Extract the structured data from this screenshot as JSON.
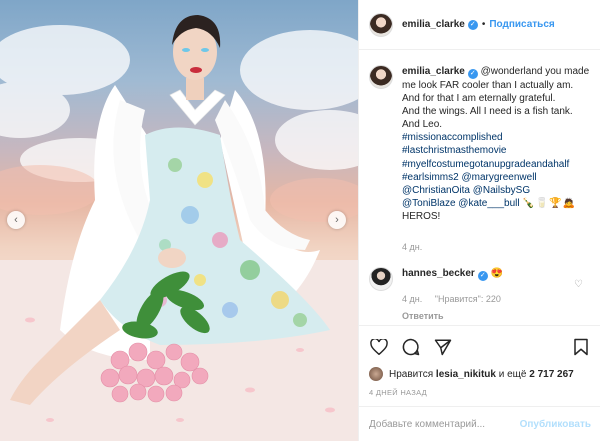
{
  "photo": {
    "prev_arrow": "‹",
    "next_arrow": "›"
  },
  "header": {
    "username": "emilia_clarke",
    "verified_icon": "✓",
    "separator": "•",
    "follow_label": "Подписаться"
  },
  "caption": {
    "username": "emilia_clarke",
    "verified_icon": "✓",
    "lines": [
      "@wonderland you made me look FAR cooler than I actually am.",
      "And for that I am eternally grateful.",
      "And the wings. All I need is a fish tank.",
      "And Leo."
    ],
    "tags": [
      "#missionaccomplished",
      "#lastchristmasthemovie",
      "#myelfcostumegotanupgradeandahalf"
    ],
    "mentions_line1": "#earlsimms2 @marygreenwell",
    "mentions_line2": "@ChristianOita @NailsbySG",
    "mentions_line3a": "@ToniBlaze @kate___bull",
    "mentions_line3_emoji": "🍾🥛🏆🙇",
    "closing": "HEROS!",
    "time": "4 дн."
  },
  "reply": {
    "username": "hannes_becker",
    "verified_icon": "✓",
    "text": "😍",
    "time": "4 дн.",
    "likes": "\"Нравится\": 220",
    "reply_label": "Ответить",
    "heart_icon": "♡"
  },
  "actions": {
    "likes_prefix": "Нравится",
    "likes_user": "lesia_nikituk",
    "likes_middle": "и ещё",
    "likes_count": "2 717 267",
    "time_ago": "4 дней назад"
  },
  "add_comment": {
    "placeholder": "Добавьте комментарий...",
    "publish_label": "Опубликовать"
  },
  "colors": {
    "accent": "#3897f0",
    "publish_disabled": "#b2dffc",
    "muted": "#999999"
  }
}
